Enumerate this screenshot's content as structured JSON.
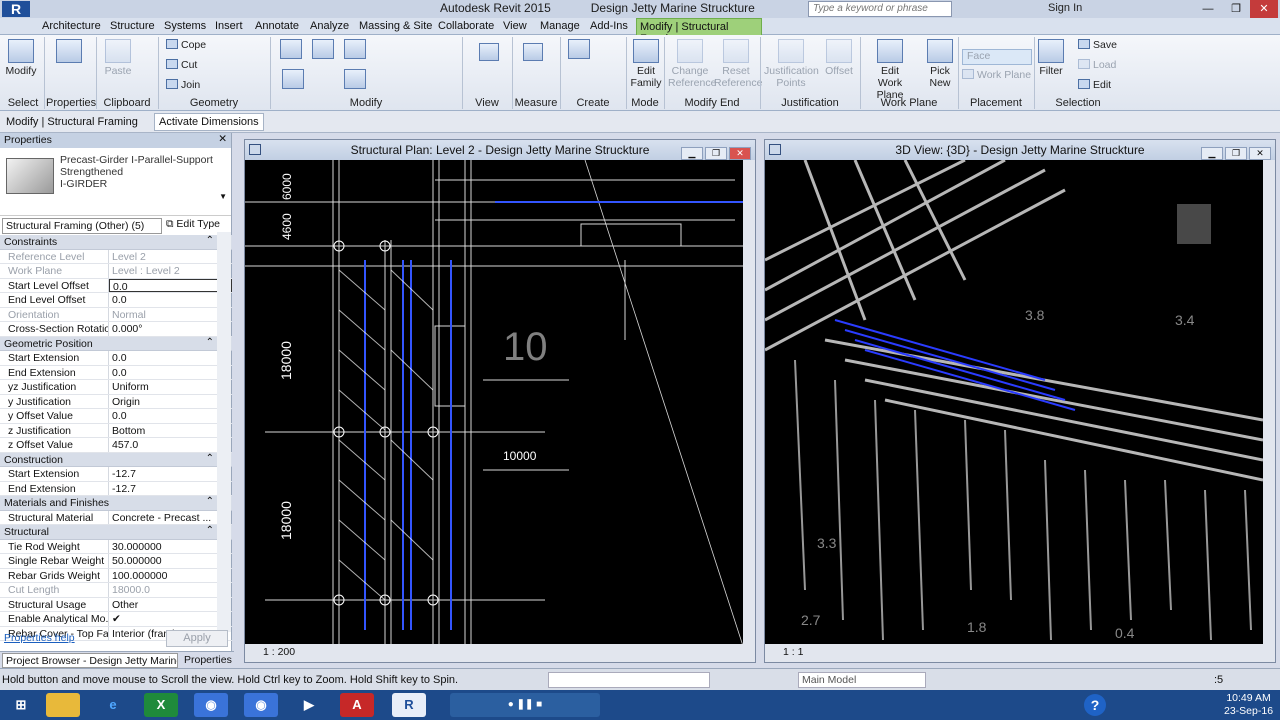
{
  "app": {
    "title": "Autodesk Revit 2015",
    "document": "Design Jetty Marine Struckture",
    "search_placeholder": "Type a keyword or phrase",
    "signin": "Sign In"
  },
  "tabs": [
    "Architecture",
    "Structure",
    "Systems",
    "Insert",
    "Annotate",
    "Analyze",
    "Massing & Site",
    "Collaborate",
    "View",
    "Manage",
    "Add-Ins"
  ],
  "active_tab": "Modify | Structural Framing",
  "ribbon": {
    "panels": [
      "Select",
      "Properties",
      "Clipboard",
      "Geometry",
      "Modify",
      "View",
      "Measure",
      "Create",
      "Mode",
      "Modify End",
      "Justification",
      "Work Plane",
      "Placement",
      "Selection"
    ],
    "modify": "Modify",
    "paste": "Paste",
    "cope": "Cope",
    "cut": "Cut",
    "join": "Join",
    "edit_family": [
      "Edit",
      "Family"
    ],
    "change_reference": [
      "Change",
      "Reference"
    ],
    "reset_reference": [
      "Reset",
      "Reference"
    ],
    "justification_points": [
      "Justification",
      "Points"
    ],
    "offset": "Offset",
    "edit_work_plane": [
      "Edit",
      "Work Plane"
    ],
    "pick_new": [
      "Pick",
      "New"
    ],
    "face": "Face",
    "work_plane": "Work Plane",
    "filter": "Filter",
    "save": "Save",
    "load": "Load",
    "edit": "Edit"
  },
  "options_bar": {
    "context": "Modify | Structural Framing",
    "activate_dimensions": "Activate Dimensions"
  },
  "properties": {
    "header": "Properties",
    "type_name": [
      "Precast-Girder I-Parallel-Support",
      "Strengthened",
      "I-GIRDER"
    ],
    "filter": "Structural Framing (Other) (5)",
    "edit_type": "Edit Type",
    "groups": [
      {
        "name": "Constraints",
        "rows": [
          {
            "k": "Reference Level",
            "v": "Level 2",
            "dim": true
          },
          {
            "k": "Work Plane",
            "v": "Level : Level 2",
            "dim": true
          },
          {
            "k": "Start Level Offset",
            "v": "0.0",
            "sel": true
          },
          {
            "k": "End Level Offset",
            "v": "0.0"
          },
          {
            "k": "Orientation",
            "v": "Normal",
            "dim": true
          },
          {
            "k": "Cross-Section Rotation",
            "v": "0.000°"
          }
        ]
      },
      {
        "name": "Geometric Position",
        "rows": [
          {
            "k": "Start Extension",
            "v": "0.0"
          },
          {
            "k": "End Extension",
            "v": "0.0"
          },
          {
            "k": "yz Justification",
            "v": "Uniform"
          },
          {
            "k": "y Justification",
            "v": "Origin"
          },
          {
            "k": "y Offset Value",
            "v": "0.0"
          },
          {
            "k": "z Justification",
            "v": "Bottom"
          },
          {
            "k": "z Offset Value",
            "v": "457.0"
          }
        ]
      },
      {
        "name": "Construction",
        "rows": [
          {
            "k": "Start Extension",
            "v": "-12.7"
          },
          {
            "k": "End Extension",
            "v": "-12.7"
          }
        ]
      },
      {
        "name": "Materials and Finishes",
        "rows": [
          {
            "k": "Structural Material",
            "v": "Concrete - Precast ..."
          }
        ]
      },
      {
        "name": "Structural",
        "rows": [
          {
            "k": "Tie Rod Weight",
            "v": "30.000000"
          },
          {
            "k": "Single Rebar Weight",
            "v": "50.000000"
          },
          {
            "k": "Rebar Grids Weight",
            "v": "100.000000"
          },
          {
            "k": "Cut Length",
            "v": "18000.0",
            "dim": true
          },
          {
            "k": "Structural Usage",
            "v": "Other"
          },
          {
            "k": "Enable Analytical Mo...",
            "v": "✔"
          },
          {
            "k": "Rebar Cover - Top Face",
            "v": "Interior (framing, c..."
          }
        ]
      }
    ],
    "help": "Properties help",
    "apply": "Apply"
  },
  "browser_tabs": {
    "project_browser": "Project Browser - Design Jetty Marine Str...",
    "properties": "Properties"
  },
  "views": {
    "plan": {
      "title": "Structural Plan: Level 2 - Design Jetty Marine Struckture",
      "scale": "1 : 200",
      "dims": [
        "6000",
        "4600",
        "18000",
        "18000",
        "10000",
        "10"
      ]
    },
    "three_d": {
      "title": "3D View: {3D} - Design Jetty Marine Struckture",
      "scale": "1 : 1",
      "levels": [
        "3.4",
        "3.3",
        "2.7",
        "1.8",
        "0.4",
        "3.8"
      ]
    }
  },
  "status": {
    "text": "Hold button and move mouse to Scroll the view. Hold Ctrl key to Zoom. Hold Shift key to Spin.",
    "model": "Main Model",
    "count": ":5"
  },
  "taskbar": {
    "time": "10:49 AM",
    "date": "23-Sep-16"
  }
}
